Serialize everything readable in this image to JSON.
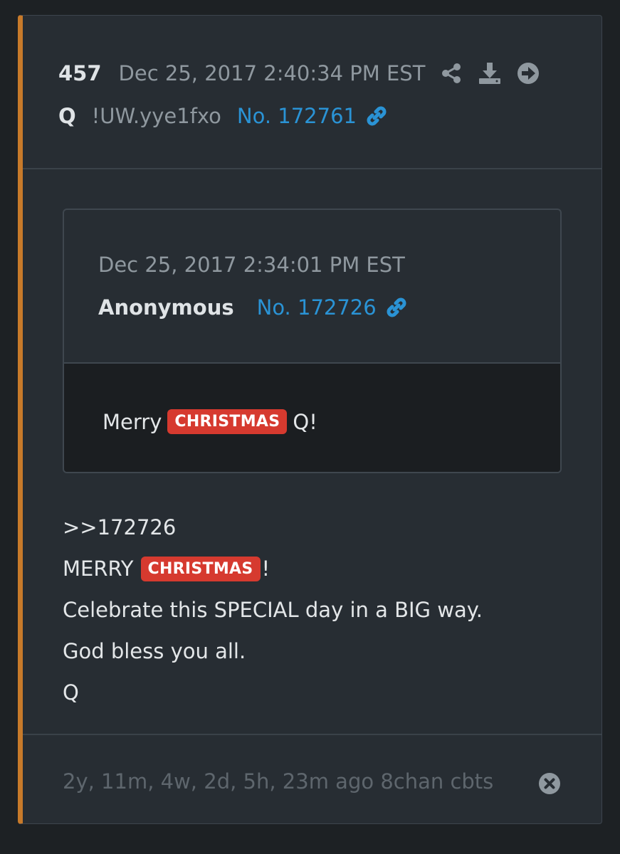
{
  "post": {
    "number": "457",
    "date": "Dec 25, 2017 2:40:34 PM EST",
    "author": "Q",
    "tripcode": "!UW.yye1fxo",
    "post_link": "No. 172761"
  },
  "icons": {
    "share": "share-icon",
    "download": "download-icon",
    "goto": "arrow-circle-right-icon",
    "link": "link-icon",
    "close": "close-circle-icon"
  },
  "quoted": {
    "date": "Dec 25, 2017 2:34:01 PM EST",
    "author": "Anonymous",
    "post_link": "No. 172726",
    "text_before": "Merry",
    "highlight": "CHRISTMAS",
    "text_after": "Q!"
  },
  "body": {
    "reply_ref": ">>172726",
    "line2_before": "MERRY",
    "line2_highlight": "CHRISTMAS",
    "line2_after": "!",
    "line3": "Celebrate this SPECIAL day in a BIG way.",
    "line4": "God bless you all.",
    "line5": "Q"
  },
  "footer": {
    "text": "2y, 11m, 4w, 2d, 5h, 23m ago 8chan cbts"
  },
  "colors": {
    "accent_border": "#c77a2a",
    "link": "#2a93d5",
    "highlight_badge": "#d63a2f",
    "card_bg": "#272d33",
    "page_bg": "#1d2124"
  }
}
